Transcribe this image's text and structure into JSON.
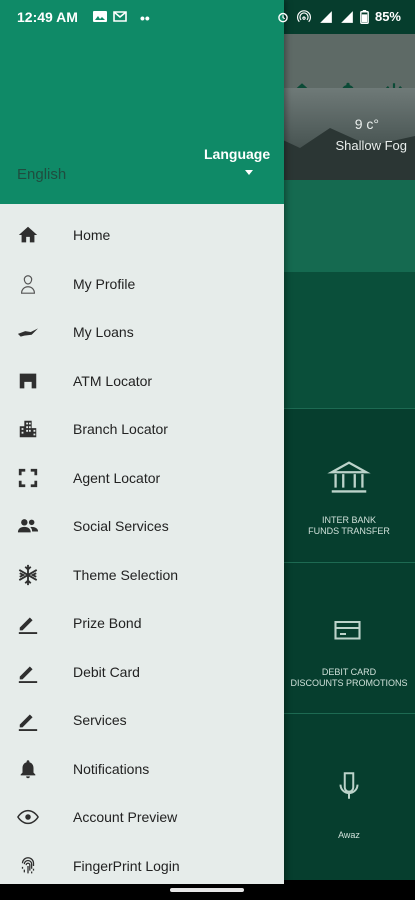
{
  "status_bar": {
    "time": "12:49 AM",
    "battery": "85%"
  },
  "drawer": {
    "language_title": "Language",
    "language_value": "English",
    "items": [
      {
        "label": "Home",
        "icon": "home-icon"
      },
      {
        "label": "My Profile",
        "icon": "profile-icon"
      },
      {
        "label": "My Loans",
        "icon": "loan-icon"
      },
      {
        "label": "ATM Locator",
        "icon": "atm-icon"
      },
      {
        "label": "Branch Locator",
        "icon": "branch-icon"
      },
      {
        "label": "Agent Locator",
        "icon": "agent-icon"
      },
      {
        "label": "Social Services",
        "icon": "people-icon"
      },
      {
        "label": "Theme Selection",
        "icon": "snowflake-icon"
      },
      {
        "label": "Prize Bond",
        "icon": "pencil-icon"
      },
      {
        "label": "Debit Card",
        "icon": "pencil-icon"
      },
      {
        "label": "Services",
        "icon": "pencil-icon"
      },
      {
        "label": "Notifications",
        "icon": "bell-icon"
      },
      {
        "label": "Account Preview",
        "icon": "eye-icon"
      },
      {
        "label": "FingerPrint Login",
        "icon": "fingerprint-icon"
      }
    ]
  },
  "background": {
    "weather": {
      "temperature": "9 c°",
      "condition": "Shallow Fog"
    },
    "tiles": [
      {
        "label_line1": "INTER BANK",
        "label_line2": "FUNDS TRANSFER"
      },
      {
        "label_line1": "DEBIT CARD",
        "label_line2": "DISCOUNTS PROMOTIONS"
      },
      {
        "label_line1": "Awaz",
        "label_line2": ""
      }
    ]
  },
  "colors": {
    "drawer_header": "#0f8a67",
    "drawer_body": "#e6ecea",
    "app_bg": "#063d2d"
  }
}
